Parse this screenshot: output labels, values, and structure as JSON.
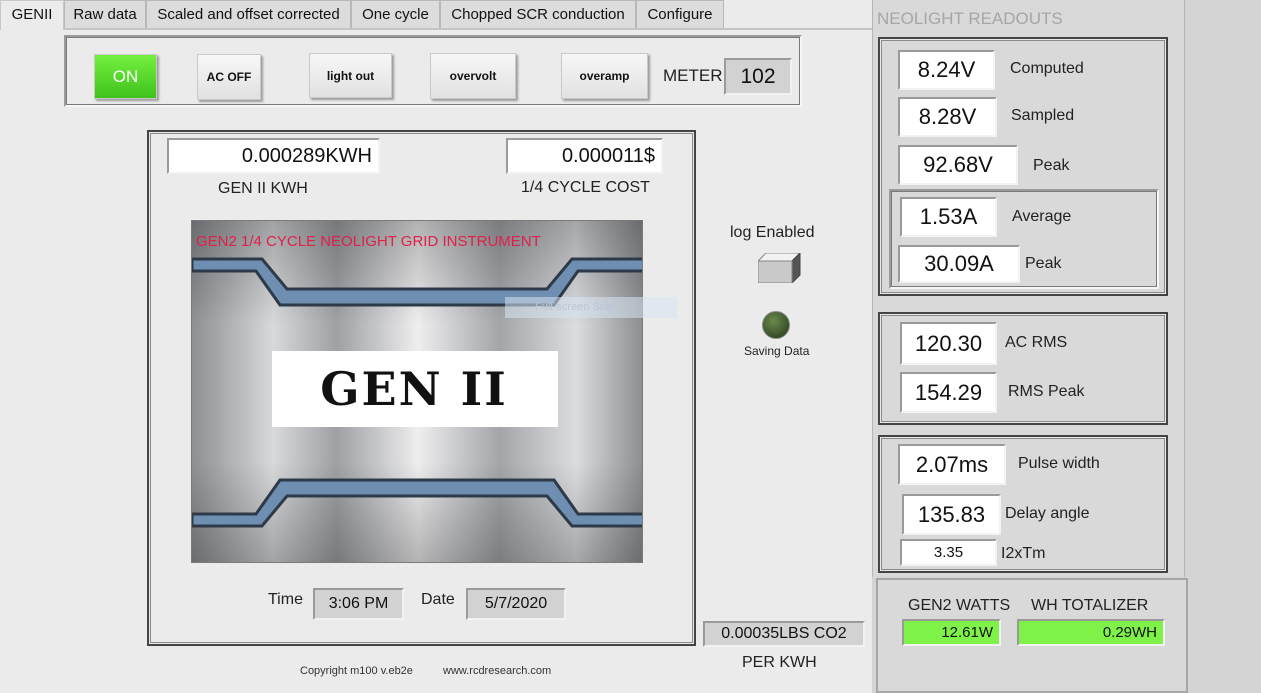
{
  "tabs": [
    "GENII",
    "Raw data",
    "Scaled and offset corrected",
    "One cycle",
    "Chopped SCR conduction",
    "Configure"
  ],
  "toolbar": {
    "on_label": "ON",
    "ac_off_label": "AC OFF",
    "light_out_label": "light out",
    "overvolt_label": "overvolt",
    "overamp_label": "overamp",
    "meter_label": "METER",
    "meter_value": "102"
  },
  "main": {
    "kwh_value": "0.000289KWH",
    "kwh_label": "GEN II KWH",
    "cost_value": "0.000011$",
    "cost_label": "1/4 CYCLE COST",
    "banner_text": "GEN2 1/4 CYCLE NEOLIGHT GRID INSTRUMENT",
    "logo_text": "GEN II",
    "snip_overlay": "Full-screen Snip",
    "time_label": "Time",
    "time_value": "3:06 PM",
    "date_label": "Date",
    "date_value": "5/7/2020"
  },
  "logging": {
    "log_label": "log Enabled",
    "saving_label": "Saving Data"
  },
  "co2": {
    "value": "0.00035LBS CO2",
    "label": "PER KWH"
  },
  "footer": {
    "copyright": "Copyright m100 v.eb2e",
    "website": "www.rcdresearch.com"
  },
  "readouts": {
    "title": "NEOLIGHT READOUTS",
    "computed_value": "8.24V",
    "computed_label": "Computed",
    "sampled_value": "8.28V",
    "sampled_label": "Sampled",
    "peak_v_value": "92.68V",
    "peak_v_label": "Peak",
    "average_a_value": "1.53A",
    "average_a_label": "Average",
    "peak_a_value": "30.09A",
    "peak_a_label": "Peak",
    "ac_rms_value": "120.30",
    "ac_rms_label": "AC RMS",
    "rms_peak_value": "154.29",
    "rms_peak_label": "RMS Peak",
    "pulse_width_value": "2.07ms",
    "pulse_width_label": "Pulse width",
    "delay_angle_value": "135.83",
    "delay_angle_label": "Delay angle",
    "i2xtm_value": "3.35",
    "i2xtm_label": "I2xTm"
  },
  "watts": {
    "watts_label": "GEN2 WATTS",
    "watts_value": "12.61W",
    "totalizer_label": "WH TOTALIZER",
    "totalizer_value": "0.29WH"
  },
  "colors": {
    "on_green": "#4fd626",
    "banner_red": "#e0204a",
    "readout_green": "#7ff24a"
  }
}
